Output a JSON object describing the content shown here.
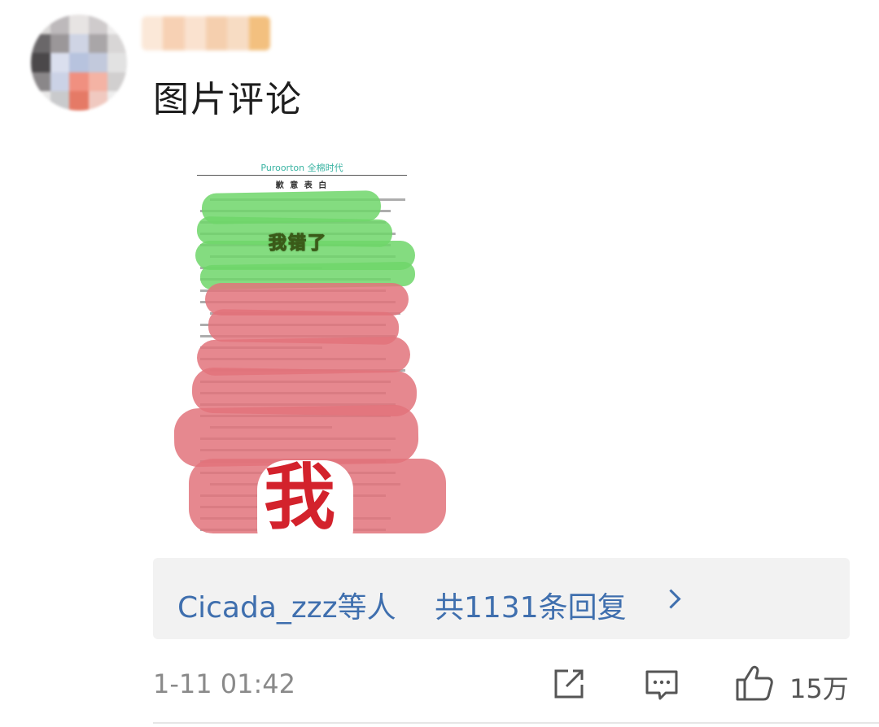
{
  "comment": {
    "text": "图片评论",
    "timestamp": "1-11 01:42"
  },
  "image": {
    "doc_logo": "Puroorton 全棉时代",
    "doc_title": "歉 意 表 白",
    "sticker_small": "我错了",
    "sticker_big": "我"
  },
  "replies": {
    "users": "Cicada_zzz",
    "suffix": "等人",
    "count": "共1131条回复"
  },
  "actions": {
    "like_count": "15万",
    "icons": [
      "share-icon",
      "comment-icon",
      "like-icon"
    ]
  },
  "colors": {
    "link": "#3f6fae",
    "highlight_green": "#6fd66a",
    "highlight_red": "#e2737b",
    "sticker_red": "#d3222c"
  }
}
